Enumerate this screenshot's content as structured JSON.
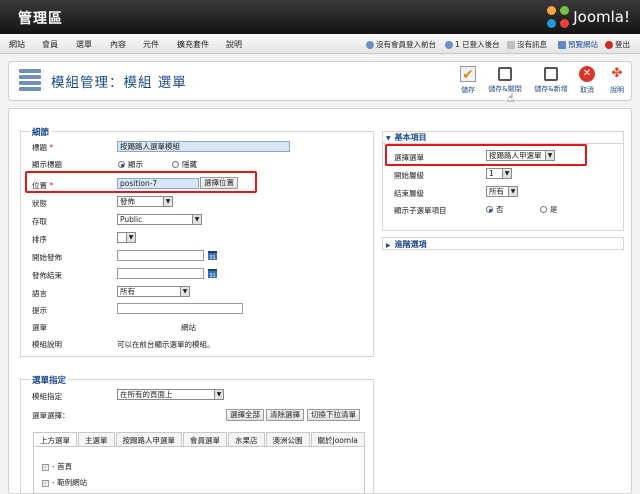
{
  "topbar": {
    "title": "管理區",
    "logo_text": "Joomla!"
  },
  "menu": [
    {
      "label": "網站"
    },
    {
      "label": "會員"
    },
    {
      "label": "選單"
    },
    {
      "label": "內容"
    },
    {
      "label": "元件"
    },
    {
      "label": "擴充套件"
    },
    {
      "label": "說明"
    }
  ],
  "status": {
    "frontend_users": "沒有會員登入前台",
    "backend_users": "1 已登入後台",
    "messages": "沒有訊息",
    "preview": "預覽網站",
    "logout": "登出"
  },
  "toolbar": {
    "page_title": "模組管理：模組 選單",
    "buttons": {
      "save": "儲存",
      "save_close": "儲存&關閉",
      "save_new": "儲存&新增",
      "cancel": "取消",
      "help": "說明"
    }
  },
  "details": {
    "legend": "細節",
    "title_label": "標題",
    "title_value": "按踢路人選單模組",
    "show_title_label": "顯示標題",
    "show_option": "顯示",
    "hide_option": "隱藏",
    "position_label": "位置",
    "position_value": "position-7",
    "select_position_button": "選擇位置",
    "status_label": "狀態",
    "status_value": "發佈",
    "access_label": "存取",
    "access_value": "Public",
    "order_label": "排序",
    "order_value": "",
    "start_publish_label": "開始發佈",
    "finish_publish_label": "發佈結束",
    "calendar_icon_text": "31",
    "language_label": "語言",
    "language_value": "所有",
    "note_label": "提示",
    "menu_label": "選單",
    "menu_value": "網站",
    "module_desc_label": "模組說明",
    "module_desc_value": "可以在前台顯示選單的模組。"
  },
  "assignment": {
    "legend": "選單指定",
    "module_assignment_label": "模組指定",
    "module_assignment_value": "在所有的頁面上",
    "menu_selection_label": "選單選擇：",
    "select_all": "選擇全部",
    "clear_selection": "清除選擇",
    "toggle_dropdown": "切換下拉清單",
    "tabs": [
      "上方選單",
      "主選單",
      "按踢路人甲選單",
      "會員選單",
      "水果店",
      "澳洲公園",
      "關於Joomla"
    ],
    "items": [
      "- 首頁",
      "- 範例網站"
    ]
  },
  "basic": {
    "header": "基本項目",
    "menu_choice_label": "選擇選單",
    "menu_choice_value": "按踢路人甲選單",
    "start_level_label": "開始層級",
    "start_level_value": "1",
    "end_level_label": "結束層級",
    "end_level_value": "所有",
    "show_submenu_label": "顯示子選單項目",
    "no_option": "否",
    "yes_option": "是"
  },
  "advanced": {
    "header": "進階選項"
  }
}
